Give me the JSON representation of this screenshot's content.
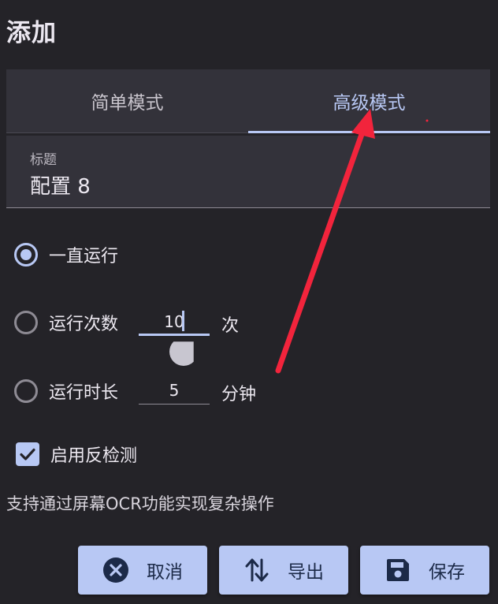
{
  "dialog": {
    "title": "添加"
  },
  "tabs": [
    {
      "label": "简单模式",
      "selected": false
    },
    {
      "label": "高级模式",
      "selected": true
    }
  ],
  "title_field": {
    "label": "标题",
    "value": "配置 8"
  },
  "run_options": {
    "always": {
      "label": "一直运行",
      "selected": true
    },
    "count": {
      "label": "运行次数",
      "value": "10",
      "unit": "次",
      "selected": false
    },
    "duration": {
      "label": "运行时长",
      "value": "5",
      "unit": "分钟",
      "selected": false
    }
  },
  "anti_detect": {
    "label": "启用反检测",
    "checked": true
  },
  "helper": "支持通过屏幕OCR功能实现复杂操作",
  "buttons": {
    "cancel": "取消",
    "export": "导出",
    "save": "保存"
  },
  "colors": {
    "background": "#242328",
    "surface": "#33323a",
    "accent": "#b8c8f4",
    "annotation_arrow": "#f2243c"
  },
  "icons": {
    "cancel": "close-circle-icon",
    "export": "swap-vertical-icon",
    "save": "floppy-disk-icon"
  }
}
